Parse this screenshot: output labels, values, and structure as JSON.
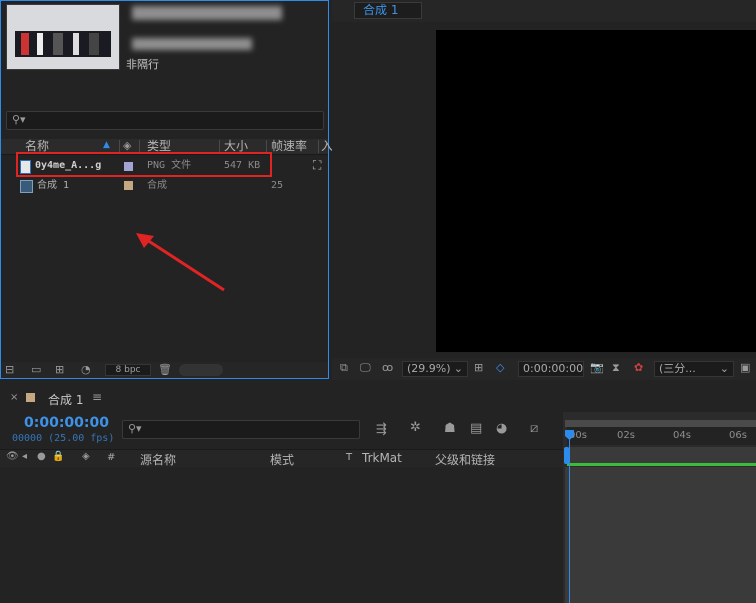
{
  "project": {
    "thumbnail_label": "",
    "info_line": "非隔行",
    "columns": {
      "name": "名称",
      "type": "类型",
      "size": "大小",
      "fps": "帧速率",
      "extra": "入"
    },
    "items": [
      {
        "name": "0y4me_A...g",
        "type": "PNG 文件",
        "size": "547 KB",
        "fps": "",
        "label_color": "#a3a3d6",
        "icon": "png-file-icon"
      },
      {
        "name": "合成 1",
        "type": "合成",
        "size": "",
        "fps": "25",
        "label_color": "#c4a882",
        "icon": "composition-icon"
      }
    ],
    "bpc": "8 bpc"
  },
  "viewer": {
    "comp_tab": "合成 1",
    "zoom": "(29.9%)",
    "timecode": "0:00:00:00",
    "resolution": "(三分..."
  },
  "timeline": {
    "tab_label": "合成 1",
    "current_time": "0:00:00:00",
    "frame_info": "00000 (25.00 fps)",
    "columns": {
      "source_name": "源名称",
      "mode": "模式",
      "t": "T",
      "trkmat": "TrkMat",
      "parent": "父级和链接",
      "hash": "#"
    },
    "ruler_ticks": [
      "00s",
      "02s",
      "04s",
      "06s"
    ]
  },
  "colors": {
    "accent": "#2d8ceb",
    "highlight_box": "#e02424",
    "arrow": "#e02424",
    "work_area_bar": "#3cbb3c"
  }
}
